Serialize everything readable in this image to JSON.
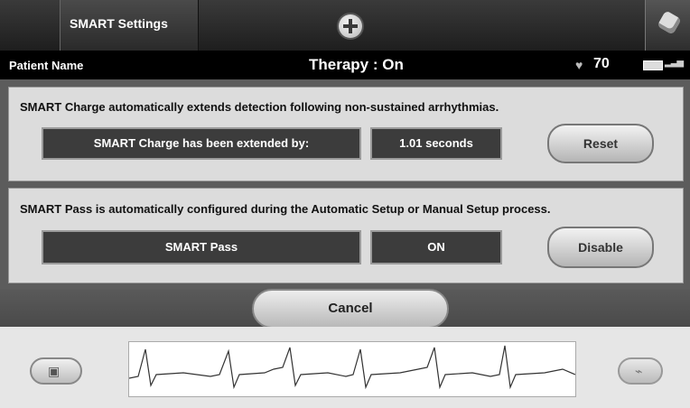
{
  "header": {
    "screen_title": "SMART Settings",
    "patient_label": "Patient Name",
    "therapy_status": "Therapy : On",
    "heart_rate": "70"
  },
  "smart_charge": {
    "description": "SMART Charge automatically extends detection following non-sustained arrhythmias.",
    "status_label": "SMART Charge has been extended by:",
    "status_value": "1.01 seconds",
    "button_label": "Reset"
  },
  "smart_pass": {
    "description": "SMART Pass is automatically configured during the Automatic Setup or Manual Setup process.",
    "status_label": "SMART Pass",
    "status_value": "ON",
    "button_label": "Disable"
  },
  "footer": {
    "cancel_label": "Cancel"
  },
  "icons": {
    "add": "plus-circle-icon",
    "device": "device-icon",
    "heart": "heart-icon",
    "battery": "battery-icon",
    "signal": "signal-icon",
    "camera": "camera-icon",
    "pulse": "pulse-icon"
  },
  "colors": {
    "header_bg": "#1e1e1e",
    "panel_bg": "#dcdcdc",
    "status_cell_bg": "#3c3c3c"
  }
}
